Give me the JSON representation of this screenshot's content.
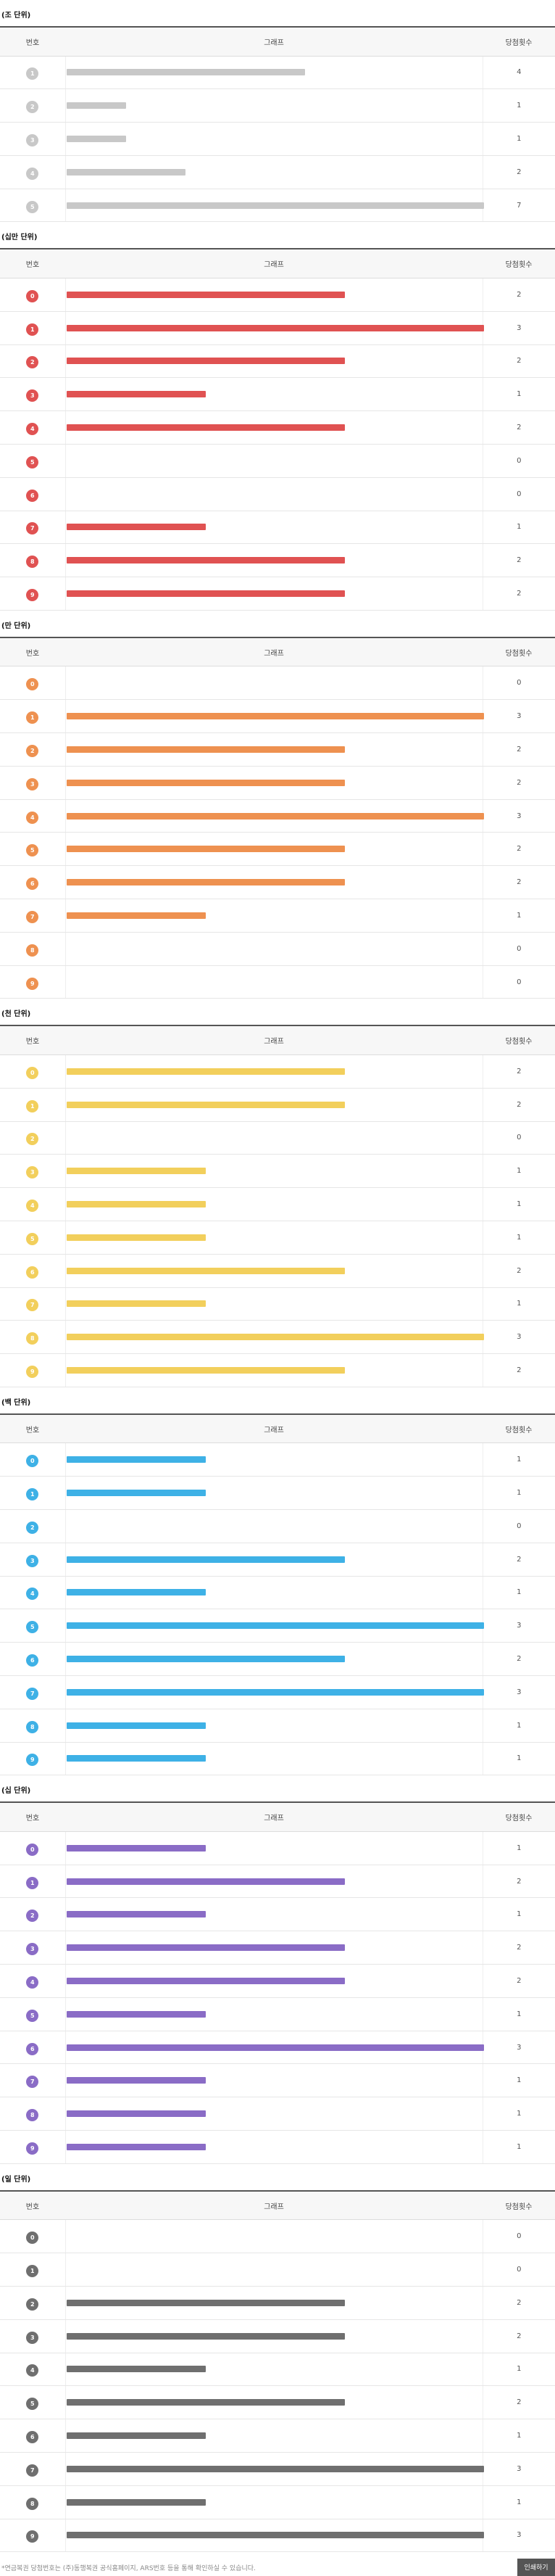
{
  "headers": {
    "num": "번호",
    "graph": "그래프",
    "count": "당첨횟수"
  },
  "sections": [
    {
      "title": "(조 단위)",
      "color": "#c8c8c8",
      "rows": [
        {
          "n": "1",
          "c": 4
        },
        {
          "n": "2",
          "c": 1
        },
        {
          "n": "3",
          "c": 1
        },
        {
          "n": "4",
          "c": 2
        },
        {
          "n": "5",
          "c": 7
        }
      ]
    },
    {
      "title": "(십만 단위)",
      "color": "#e05252",
      "rows": [
        {
          "n": "0",
          "c": 2
        },
        {
          "n": "1",
          "c": 3
        },
        {
          "n": "2",
          "c": 2
        },
        {
          "n": "3",
          "c": 1
        },
        {
          "n": "4",
          "c": 2
        },
        {
          "n": "5",
          "c": 0
        },
        {
          "n": "6",
          "c": 0
        },
        {
          "n": "7",
          "c": 1
        },
        {
          "n": "8",
          "c": 2
        },
        {
          "n": "9",
          "c": 2
        }
      ]
    },
    {
      "title": "(만 단위)",
      "color": "#ee9150",
      "rows": [
        {
          "n": "0",
          "c": 0
        },
        {
          "n": "1",
          "c": 3
        },
        {
          "n": "2",
          "c": 2
        },
        {
          "n": "3",
          "c": 2
        },
        {
          "n": "4",
          "c": 3
        },
        {
          "n": "5",
          "c": 2
        },
        {
          "n": "6",
          "c": 2
        },
        {
          "n": "7",
          "c": 1
        },
        {
          "n": "8",
          "c": 0
        },
        {
          "n": "9",
          "c": 0
        }
      ]
    },
    {
      "title": "(천 단위)",
      "color": "#f2cf5c",
      "rows": [
        {
          "n": "0",
          "c": 2
        },
        {
          "n": "1",
          "c": 2
        },
        {
          "n": "2",
          "c": 0
        },
        {
          "n": "3",
          "c": 1
        },
        {
          "n": "4",
          "c": 1
        },
        {
          "n": "5",
          "c": 1
        },
        {
          "n": "6",
          "c": 2
        },
        {
          "n": "7",
          "c": 1
        },
        {
          "n": "8",
          "c": 3
        },
        {
          "n": "9",
          "c": 2
        }
      ]
    },
    {
      "title": "(백 단위)",
      "color": "#3eb1e6",
      "rows": [
        {
          "n": "0",
          "c": 1
        },
        {
          "n": "1",
          "c": 1
        },
        {
          "n": "2",
          "c": 0
        },
        {
          "n": "3",
          "c": 2
        },
        {
          "n": "4",
          "c": 1
        },
        {
          "n": "5",
          "c": 3
        },
        {
          "n": "6",
          "c": 2
        },
        {
          "n": "7",
          "c": 3
        },
        {
          "n": "8",
          "c": 1
        },
        {
          "n": "9",
          "c": 1
        }
      ]
    },
    {
      "title": "(십 단위)",
      "color": "#8a6cc6",
      "rows": [
        {
          "n": "0",
          "c": 1
        },
        {
          "n": "1",
          "c": 2
        },
        {
          "n": "2",
          "c": 1
        },
        {
          "n": "3",
          "c": 2
        },
        {
          "n": "4",
          "c": 2
        },
        {
          "n": "5",
          "c": 1
        },
        {
          "n": "6",
          "c": 3
        },
        {
          "n": "7",
          "c": 1
        },
        {
          "n": "8",
          "c": 1
        },
        {
          "n": "9",
          "c": 1
        }
      ]
    },
    {
      "title": "(일 단위)",
      "color": "#6f6f6f",
      "rows": [
        {
          "n": "0",
          "c": 0
        },
        {
          "n": "1",
          "c": 0
        },
        {
          "n": "2",
          "c": 2
        },
        {
          "n": "3",
          "c": 2
        },
        {
          "n": "4",
          "c": 1
        },
        {
          "n": "5",
          "c": 2
        },
        {
          "n": "6",
          "c": 1
        },
        {
          "n": "7",
          "c": 3
        },
        {
          "n": "8",
          "c": 1
        },
        {
          "n": "9",
          "c": 3
        }
      ]
    }
  ],
  "footer": {
    "note": "*연금복권 당첨번호는 (주)동행복권 공식홈페이지, ARS번호 등을 통해 확인하실 수 있습니다.",
    "print_label": "인쇄하기"
  }
}
